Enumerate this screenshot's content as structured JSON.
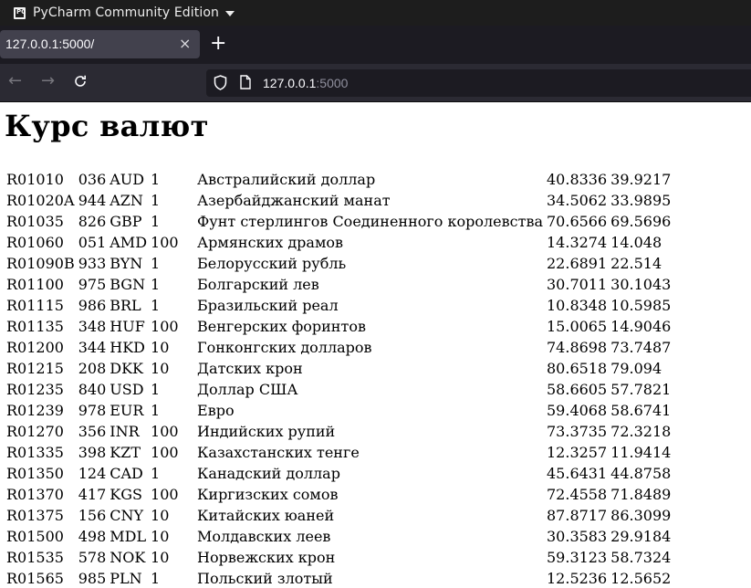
{
  "os_bar": {
    "app_name": "PyCharm Community Edition"
  },
  "browser": {
    "tab_title": "127.0.0.1:5000/",
    "tab_close": "×",
    "new_tab": "+",
    "url_host": "127.0.0.1",
    "url_port": ":5000"
  },
  "page": {
    "heading": "Курс валют",
    "rows": [
      [
        "R01010",
        "036",
        "AUD",
        "1",
        "Австралийский доллар",
        "40.8336",
        "39.9217"
      ],
      [
        "R01020A",
        "944",
        "AZN",
        "1",
        "Азербайджанский манат",
        "34.5062",
        "33.9895"
      ],
      [
        "R01035",
        "826",
        "GBP",
        "1",
        "Фунт стерлингов Соединенного королевства",
        "70.6566",
        "69.5696"
      ],
      [
        "R01060",
        "051",
        "AMD",
        "100",
        "Армянских драмов",
        "14.3274",
        "14.048"
      ],
      [
        "R01090B",
        "933",
        "BYN",
        "1",
        "Белорусский рубль",
        "22.6891",
        "22.514"
      ],
      [
        "R01100",
        "975",
        "BGN",
        "1",
        "Болгарский лев",
        "30.7011",
        "30.1043"
      ],
      [
        "R01115",
        "986",
        "BRL",
        "1",
        "Бразильский реал",
        "10.8348",
        "10.5985"
      ],
      [
        "R01135",
        "348",
        "HUF",
        "100",
        "Венгерских форинтов",
        "15.0065",
        "14.9046"
      ],
      [
        "R01200",
        "344",
        "HKD",
        "10",
        "Гонконгских долларов",
        "74.8698",
        "73.7487"
      ],
      [
        "R01215",
        "208",
        "DKK",
        "10",
        "Датских крон",
        "80.6518",
        "79.094"
      ],
      [
        "R01235",
        "840",
        "USD",
        "1",
        "Доллар США",
        "58.6605",
        "57.7821"
      ],
      [
        "R01239",
        "978",
        "EUR",
        "1",
        "Евро",
        "59.4068",
        "58.6741"
      ],
      [
        "R01270",
        "356",
        "INR",
        "100",
        "Индийских рупий",
        "73.3735",
        "72.3218"
      ],
      [
        "R01335",
        "398",
        "KZT",
        "100",
        "Казахстанских тенге",
        "12.3257",
        "11.9414"
      ],
      [
        "R01350",
        "124",
        "CAD",
        "1",
        "Канадский доллар",
        "45.6431",
        "44.8758"
      ],
      [
        "R01370",
        "417",
        "KGS",
        "100",
        "Киргизских сомов",
        "72.4558",
        "71.8489"
      ],
      [
        "R01375",
        "156",
        "CNY",
        "10",
        "Китайских юаней",
        "87.8717",
        "86.3099"
      ],
      [
        "R01500",
        "498",
        "MDL",
        "10",
        "Молдавских леев",
        "30.3583",
        "29.9184"
      ],
      [
        "R01535",
        "578",
        "NOK",
        "10",
        "Норвежских крон",
        "59.3123",
        "58.7324"
      ],
      [
        "R01565",
        "985",
        "PLN",
        "1",
        "Польский злотый",
        "12.5236",
        "12.5652"
      ]
    ]
  }
}
